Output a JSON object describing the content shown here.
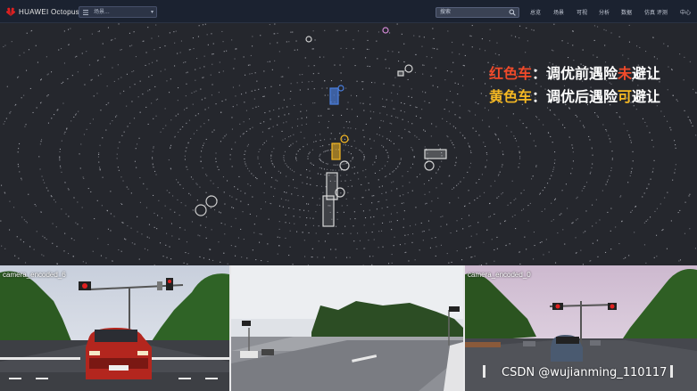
{
  "topbar": {
    "logo_text": "HUAWEI Octopus",
    "dataset_select": "场景...",
    "search_placeholder": "搜索",
    "nav": [
      "总览",
      "场景",
      "可视",
      "分析",
      "数据",
      "仿真 评测",
      "中心"
    ]
  },
  "legend": {
    "red_label": "红色车",
    "red_pre": "：调优前遇险",
    "red_highlight": "未",
    "red_post": "避让",
    "yellow_label": "黄色车",
    "yellow_pre": "：调优后遇险",
    "yellow_highlight": "可",
    "yellow_post": "避让"
  },
  "cameras": [
    {
      "label": "camera_encoded_6"
    },
    {
      "label": ""
    },
    {
      "label": "camera_encoded_0"
    }
  ],
  "watermark": "CSDN @wujianming_110117",
  "colors": {
    "red": "#f04a2a",
    "yellow": "#f5b823",
    "blue_car": "#4a7fe0",
    "background": "#25272d"
  }
}
